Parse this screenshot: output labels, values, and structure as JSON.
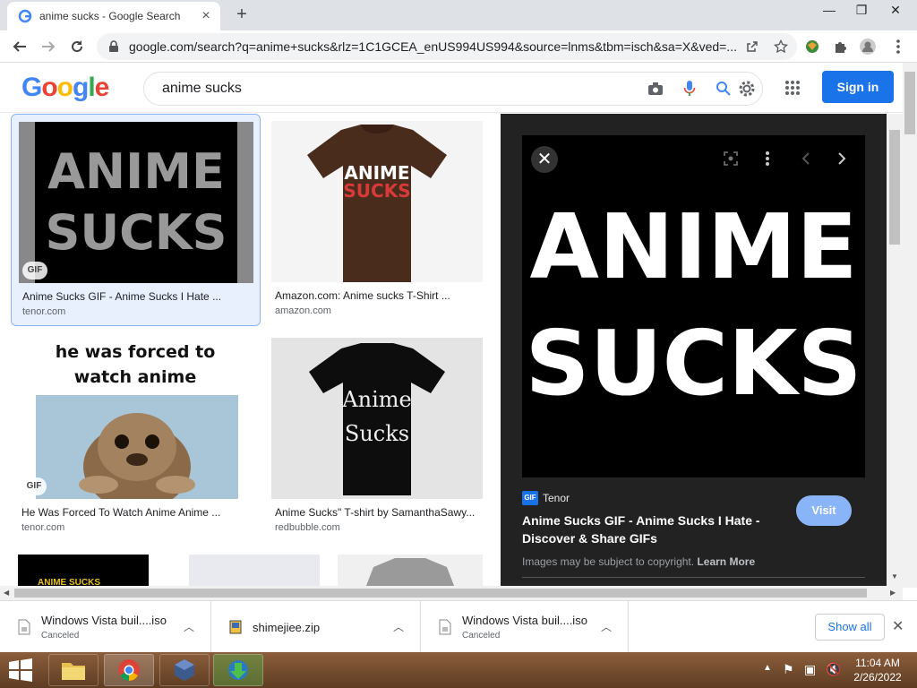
{
  "browser": {
    "tab_title": "anime sucks - Google Search",
    "new_tab_symbol": "+",
    "url": "google.com/search?q=anime+sucks&rlz=1C1GCEA_enUS994US994&source=lnms&tbm=isch&sa=X&ved=..."
  },
  "google": {
    "logo": [
      "G",
      "o",
      "o",
      "g",
      "l",
      "e"
    ],
    "logo_colors": [
      "#4285f4",
      "#ea4335",
      "#fbbc05",
      "#4285f4",
      "#34a853",
      "#ea4335"
    ],
    "query": "anime sucks",
    "signin_label": "Sign in"
  },
  "results": [
    {
      "title": "Anime Sucks GIF - Anime Sucks I Hate ...",
      "source": "tenor.com",
      "badge": "GIF",
      "thumb_text": [
        "ANIME",
        "SUCKS"
      ]
    },
    {
      "title": "Amazon.com: Anime sucks T-Shirt ...",
      "source": "amazon.com",
      "thumb_text": [
        "ANIME",
        "SUCKS"
      ]
    },
    {
      "title": "He Was Forced To Watch Anime Anime ...",
      "source": "tenor.com",
      "badge": "GIF",
      "thumb_text": [
        "he was forced to",
        "watch anime"
      ]
    },
    {
      "title": "Anime Sucks\" T-shirt by SamanthaSawy...",
      "source": "redbubble.com",
      "thumb_text": [
        "Anime",
        "Sucks"
      ]
    }
  ],
  "partial_row_text": "ANIME SUCKS",
  "preview": {
    "image_text": [
      "ANIME",
      "SUCKS"
    ],
    "source_badge": "GIF",
    "source_name": "Tenor",
    "title": "Anime Sucks GIF - Anime Sucks I Hate - Discover & Share GIFs",
    "visit_label": "Visit",
    "copyright": "Images may be subject to copyright.",
    "learn_more": "Learn More"
  },
  "downloads": [
    {
      "name": "Windows Vista buil....iso",
      "status": "Canceled"
    },
    {
      "name": "shimejiee.zip",
      "status": ""
    },
    {
      "name": "Windows Vista buil....iso",
      "status": "Canceled"
    }
  ],
  "downloads_show_all": "Show all",
  "clock": {
    "time": "11:04 AM",
    "date": "2/26/2022"
  }
}
